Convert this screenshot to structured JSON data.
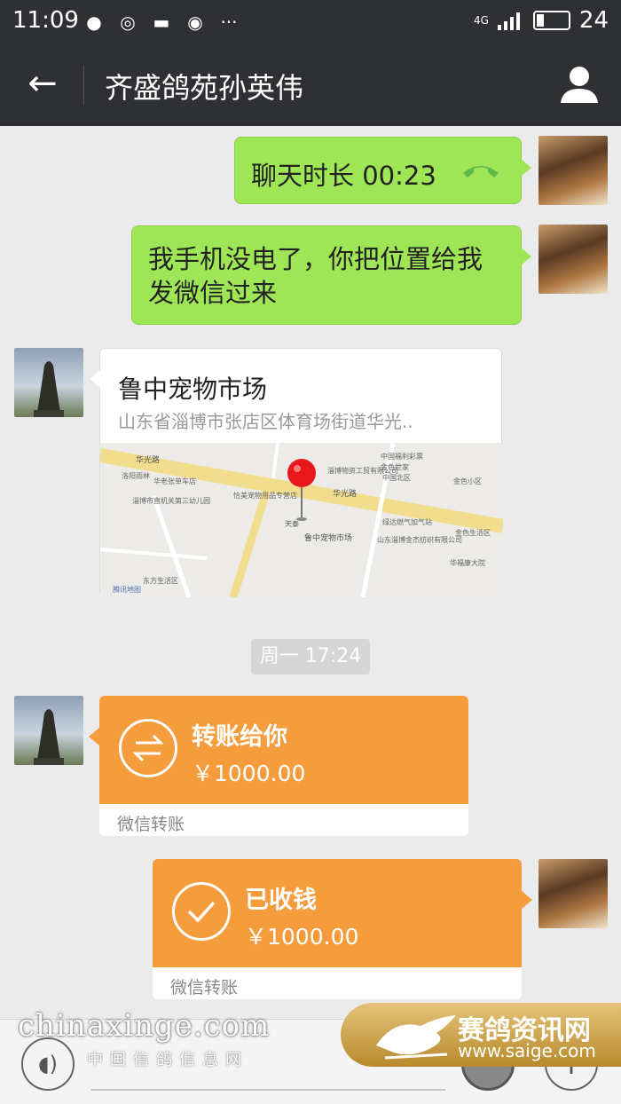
{
  "status_bar": {
    "time": "11:09",
    "network": "4G",
    "battery": "24",
    "notif_icons": [
      "chat-bubble-icon",
      "q-icon",
      "message-icon",
      "weibo-icon",
      "more-dots-icon"
    ]
  },
  "header": {
    "title": "齐盛鸽苑孙英伟"
  },
  "messages": {
    "call": {
      "text": "聊天时长 00:23"
    },
    "text": {
      "line1": "我手机没电了，你把位置给我",
      "line2": "发微信过来"
    },
    "location": {
      "name": "鲁中宠物市场",
      "address": "山东省淄博市张店区体育场街道华光..",
      "map_labels": [
        "华光路",
        "华光路",
        "鲁中宠物市场",
        "天泰",
        "淄博物资工贸有限公司",
        "中国福利彩票",
        "金色世家",
        "金色小区",
        "绿达燃气加气站",
        "山东淄博金杰纺织有限公司",
        "中国北区",
        "华福康大院",
        "淄博市直机关第三幼儿园",
        "洛阳雨林",
        "华老张单车店",
        "东方生活区",
        "金色生活区",
        "恰美宠物用品专营店",
        "腾讯地图"
      ]
    },
    "timestamp": "周一 17:24",
    "transfer_in": {
      "title": "转账给你",
      "amount": "￥1000.00",
      "footer": "微信转账"
    },
    "transfer_received": {
      "title": "已收钱",
      "amount": "￥1000.00",
      "footer": "微信转账"
    }
  },
  "watermark": {
    "left_main": "chinaxinge.com",
    "left_sub": "中国信鸽信息网",
    "right_main": "赛鸽资讯网",
    "right_sub": "www.saige.com"
  },
  "colors": {
    "topbar": "#2f3033",
    "green_bubble": "#9fe656",
    "transfer_orange": "#f59c3c",
    "background": "#ebebeb"
  }
}
